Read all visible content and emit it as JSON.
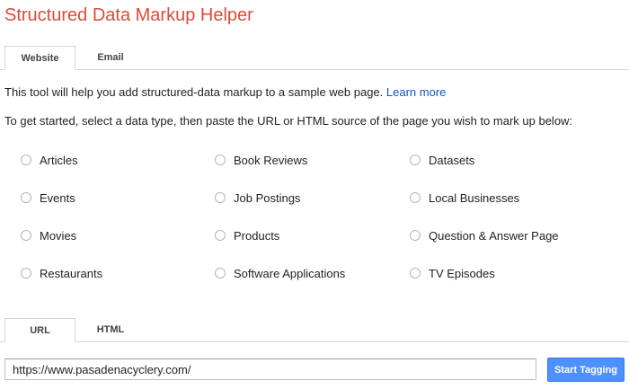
{
  "app": {
    "title": "Structured Data Markup Helper"
  },
  "source_tabs": [
    {
      "label": "Website",
      "active": true
    },
    {
      "label": "Email",
      "active": false
    }
  ],
  "intro": {
    "text": "This tool will help you add structured-data markup to a sample web page. ",
    "link_label": "Learn more"
  },
  "instruction": "To get started, select a data type, then paste the URL or HTML source of the page you wish to mark up below:",
  "data_types": [
    {
      "label": "Articles",
      "selected": false
    },
    {
      "label": "Book Reviews",
      "selected": false
    },
    {
      "label": "Datasets",
      "selected": false
    },
    {
      "label": "Events",
      "selected": false
    },
    {
      "label": "Job Postings",
      "selected": false
    },
    {
      "label": "Local Businesses",
      "selected": false
    },
    {
      "label": "Movies",
      "selected": false
    },
    {
      "label": "Products",
      "selected": false
    },
    {
      "label": "Question & Answer Page",
      "selected": false
    },
    {
      "label": "Restaurants",
      "selected": false
    },
    {
      "label": "Software Applications",
      "selected": false
    },
    {
      "label": "TV Episodes",
      "selected": false
    }
  ],
  "input_tabs": [
    {
      "label": "URL",
      "active": true
    },
    {
      "label": "HTML",
      "active": false
    }
  ],
  "url_input": {
    "value": "https://www.pasadenacyclery.com/",
    "placeholder": ""
  },
  "start_button": {
    "label": "Start Tagging"
  },
  "colors": {
    "title": "#dd4b39",
    "link": "#1155cc",
    "primary_button": "#4d90fe"
  }
}
